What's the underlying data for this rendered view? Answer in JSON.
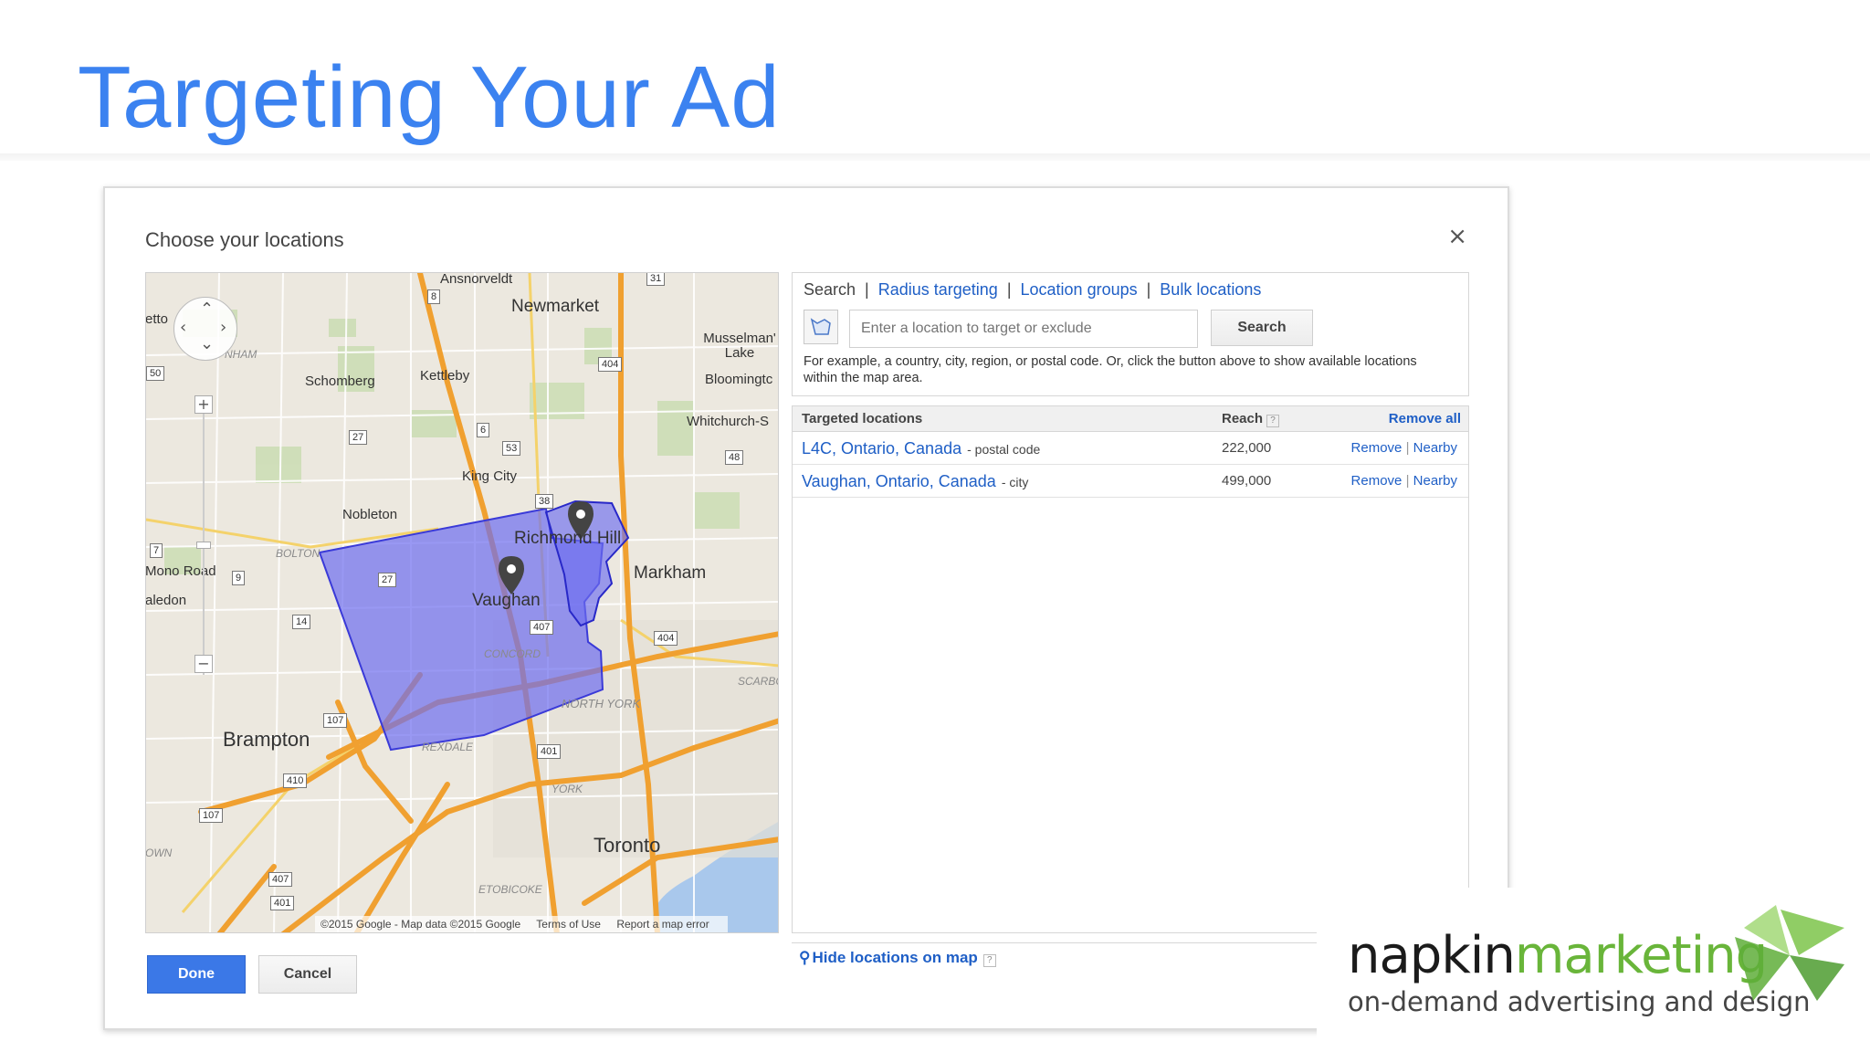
{
  "slide": {
    "title": "Targeting Your Ad"
  },
  "dialog": {
    "title": "Choose your locations",
    "close_symbol": "×",
    "done_label": "Done",
    "cancel_label": "Cancel"
  },
  "map": {
    "places": {
      "ansnorveldt": "Ansnorveldt",
      "newmarket": "Newmarket",
      "musselman": "Musselman' Lake",
      "bloomington": "Bloomingtc",
      "whitchurch": "Whitchurch-S",
      "schomberg": "Schomberg",
      "kettleby": "Kettleby",
      "king_city": "King City",
      "nobleton": "Nobleton",
      "richmond_hill": "Richmond Hill",
      "markham": "Markham",
      "vaughan": "Vaughan",
      "mono_road": "Mono Road",
      "caledon": "aledon",
      "etto": "etto",
      "brampton": "Brampton",
      "north_york": "NORTH YORK",
      "york": "YORK",
      "toronto": "Toronto",
      "etobicoke": "ETOBICOKE",
      "concord": "CONCORD",
      "rexdale": "REXDALE",
      "bolton": "BOLTON",
      "scarb": "SCARBC",
      "own": "OWN",
      "nham": "NHAM"
    },
    "shields": [
      "8",
      "31",
      "404",
      "50",
      "27",
      "6",
      "53",
      "48",
      "38",
      "7",
      "9",
      "27",
      "14",
      "407",
      "404",
      "107",
      "401",
      "410",
      "107",
      "407",
      "401"
    ],
    "footer": {
      "copyright": "©2015 Google - Map data ©2015 Google",
      "terms": "Terms of Use",
      "report": "Report a map error"
    }
  },
  "panel": {
    "tabs": {
      "search": "Search",
      "radius": "Radius targeting",
      "groups": "Location groups",
      "bulk": "Bulk locations",
      "separator": "|"
    },
    "input_placeholder": "Enter a location to target or exclude",
    "search_button": "Search",
    "hint": "For example, a country, city, region, or postal code. Or, click the button above to show available locations within the map area.",
    "table": {
      "col_locations": "Targeted locations",
      "col_reach": "Reach",
      "help_symbol": "?",
      "remove_all": "Remove all",
      "rows": [
        {
          "name": "L4C, Ontario, Canada",
          "type": "- postal code",
          "reach": "222,000",
          "remove": "Remove",
          "sep": "|",
          "nearby": "Nearby"
        },
        {
          "name": "Vaughan, Ontario, Canada",
          "type": "- city",
          "reach": "499,000",
          "remove": "Remove",
          "sep": "|",
          "nearby": "Nearby"
        }
      ]
    },
    "hide_link": "Hide locations on map"
  },
  "logo": {
    "word1": "napkin",
    "word2": "marketing",
    "tagline": "on-demand advertising and design",
    "brand_color": "#69b53a"
  },
  "colors": {
    "title_blue": "#3b82f0",
    "link_blue": "#1f5fc6",
    "done_blue": "#3b78e7",
    "region_fill": "#6d6df0"
  }
}
